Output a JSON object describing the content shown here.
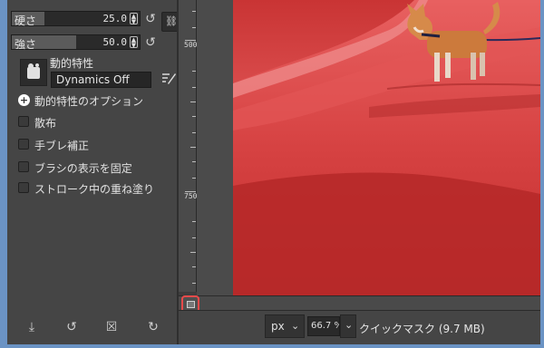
{
  "tool_options": {
    "hardness": {
      "label": "硬さ",
      "value": "25.0",
      "fill_fraction": 0.25
    },
    "force": {
      "label": "強さ",
      "value": "50.0",
      "fill_fraction": 0.5
    },
    "dynamics": {
      "title": "動的特性",
      "value": "Dynamics Off"
    },
    "options_expander": "動的特性のオプション",
    "checkboxes": [
      {
        "label": "散布",
        "checked": false
      },
      {
        "label": "手ブレ補正",
        "checked": false
      },
      {
        "label": "ブラシの表示を固定",
        "checked": false
      },
      {
        "label": "ストローク中の重ね塗り",
        "checked": false
      }
    ]
  },
  "ruler": {
    "labels": [
      "500",
      "750"
    ]
  },
  "status_bar": {
    "unit": "px",
    "zoom": "66.7 %",
    "message": "クイックマスク (9.7 MB)"
  },
  "colors": {
    "quick_mask_tint": "#d93a3a",
    "highlight_ring": "#e84a4a",
    "window_frame": "#6b93c4"
  }
}
